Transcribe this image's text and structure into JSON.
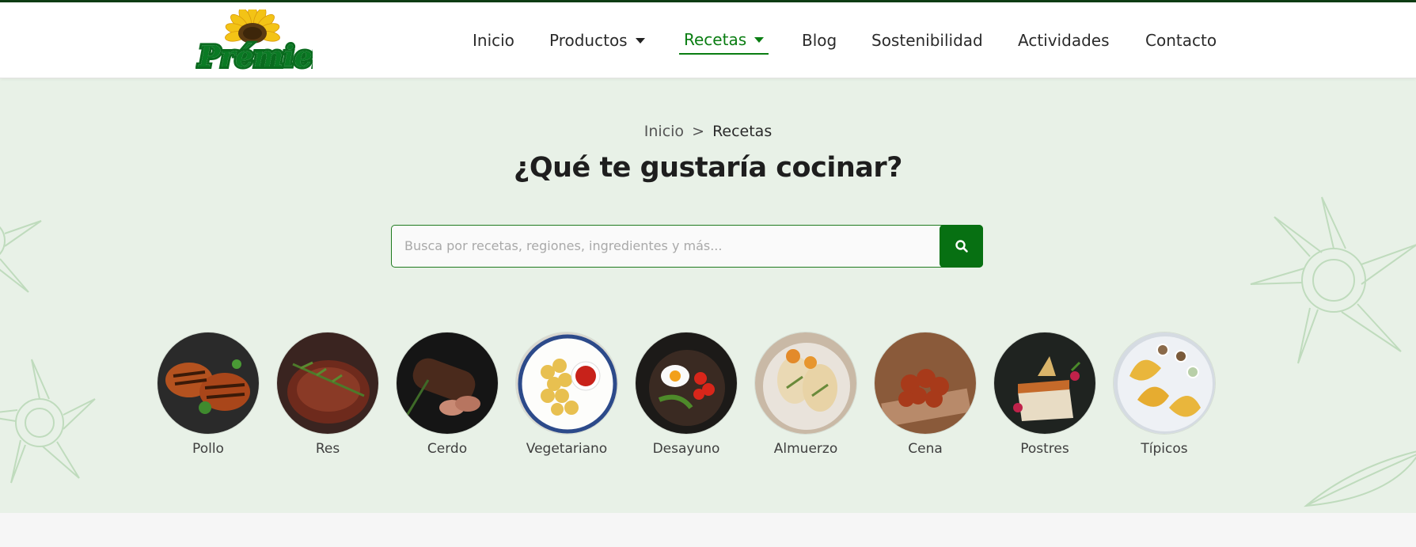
{
  "header": {
    "nav": [
      {
        "label": "Inicio",
        "dropdown": false,
        "active": false
      },
      {
        "label": "Productos",
        "dropdown": true,
        "active": false
      },
      {
        "label": "Recetas",
        "dropdown": true,
        "active": true
      },
      {
        "label": "Blog",
        "dropdown": false,
        "active": false
      },
      {
        "label": "Sostenibilidad",
        "dropdown": false,
        "active": false
      },
      {
        "label": "Actividades",
        "dropdown": false,
        "active": false
      },
      {
        "label": "Contacto",
        "dropdown": false,
        "active": false
      }
    ],
    "logo_icon": "sunflower-logo"
  },
  "colors": {
    "accent": "#077012",
    "hero_bg": "#e8f1e7",
    "top_border": "#0f3d14"
  },
  "hero": {
    "breadcrumb": {
      "home": "Inicio",
      "separator": ">",
      "current": "Recetas"
    },
    "title": "¿Qué te gustaría cocinar?",
    "search": {
      "placeholder": "Busca por recetas, regiones, ingredientes y más...",
      "value": "",
      "button_icon": "search-icon"
    },
    "categories": [
      {
        "label": "Pollo"
      },
      {
        "label": "Res"
      },
      {
        "label": "Cerdo"
      },
      {
        "label": "Vegetariano"
      },
      {
        "label": "Desayuno"
      },
      {
        "label": "Almuerzo"
      },
      {
        "label": "Cena"
      },
      {
        "label": "Postres"
      },
      {
        "label": "Típicos"
      }
    ]
  }
}
